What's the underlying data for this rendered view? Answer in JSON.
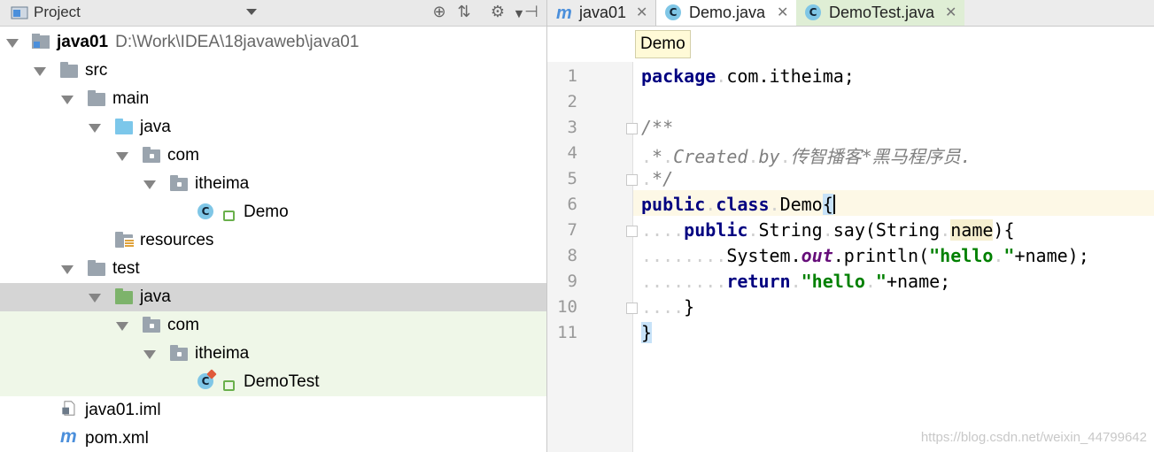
{
  "project_panel": {
    "title": "Project",
    "tree": [
      {
        "label": "java01",
        "path": "D:\\Work\\IDEA\\18javaweb\\java01",
        "type": "module"
      },
      {
        "label": "src",
        "type": "folder"
      },
      {
        "label": "main",
        "type": "folder"
      },
      {
        "label": "java",
        "type": "source-folder"
      },
      {
        "label": "com",
        "type": "package"
      },
      {
        "label": "itheima",
        "type": "package"
      },
      {
        "label": "Demo",
        "type": "class"
      },
      {
        "label": "resources",
        "type": "resources-folder"
      },
      {
        "label": "test",
        "type": "folder"
      },
      {
        "label": "java",
        "type": "test-folder"
      },
      {
        "label": "com",
        "type": "package"
      },
      {
        "label": "itheima",
        "type": "package"
      },
      {
        "label": "DemoTest",
        "type": "test-class"
      },
      {
        "label": "java01.iml",
        "type": "file"
      },
      {
        "label": "pom.xml",
        "type": "maven-file"
      }
    ]
  },
  "tabs": [
    {
      "label": "java01",
      "icon": "maven-icon"
    },
    {
      "label": "Demo.java",
      "icon": "class-icon",
      "active": true
    },
    {
      "label": "DemoTest.java",
      "icon": "test-class-icon"
    }
  ],
  "breadcrumb": "Demo",
  "editor": {
    "line_numbers": [
      "1",
      "2",
      "3",
      "4",
      "5",
      "6",
      "7",
      "8",
      "9",
      "10",
      "11"
    ],
    "code": {
      "l1_kw": "package",
      "l1_rest": "com.itheima;",
      "l3": "/**",
      "l4_a": "*",
      "l4_b": "Created",
      "l4_c": "by",
      "l4_d": "传智播客*黑马程序员.",
      "l5": "*/",
      "l6_kw1": "public",
      "l6_kw2": "class",
      "l6_name": "Demo",
      "l6_brace": "{",
      "l7_kw": "public",
      "l7_type": "String",
      "l7_method": "say(String",
      "l7_param": "name",
      "l7_end": "){",
      "l8_obj": "System.",
      "l8_field": "out",
      "l8_call": ".println(",
      "l8_str1": "\"hello",
      "l8_str2": "\"",
      "l8_end": "+name);",
      "l9_kw": "return",
      "l9_str1": "\"hello",
      "l9_str2": "\"",
      "l9_end": "+name;",
      "l10": "}",
      "l11": "}"
    }
  },
  "watermark": "https://blog.csdn.net/weixin_44799642",
  "colors": {
    "keyword": "#000080",
    "string": "#008000",
    "comment": "#808080",
    "field": "#660e7a"
  }
}
